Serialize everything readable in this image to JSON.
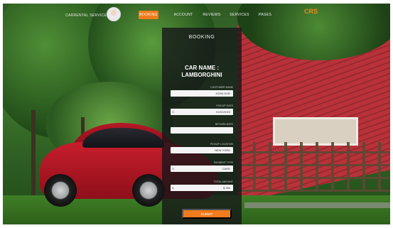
{
  "nav": {
    "brand": "CARRENTAL SERVICE",
    "items": [
      {
        "label": "BOOKING",
        "active": true
      },
      {
        "label": "ACCOUNT",
        "active": false
      },
      {
        "label": "REVIEWS",
        "active": false
      },
      {
        "label": "SERVICES",
        "active": false
      },
      {
        "label": "PAGES",
        "active": false
      }
    ],
    "logo": "CRS"
  },
  "booking": {
    "title": "BOOKING",
    "car_name_line1": "CAR NAME :",
    "car_name_line2": "LAMBORGHINI",
    "fields": [
      {
        "label": "CUSTOMER NAME",
        "value": "JOHN DOE",
        "lead": ""
      },
      {
        "label": "PICKUP DATE",
        "value": "01/01/2023",
        "lead": "O"
      },
      {
        "label": "RETURN DATE",
        "value": "",
        "lead": ""
      },
      {
        "label": "PICKUP LOCATION",
        "value": "NEW YORK",
        "lead": ""
      },
      {
        "label": "PAYMENT TYPE",
        "value": "CARD",
        "lead": "O"
      },
      {
        "label": "TOTAL AMOUNT",
        "value": "$ 250",
        "lead": "$"
      }
    ],
    "submit_label": "SUBMIT"
  },
  "colors": {
    "accent": "#f07c1e",
    "panel": "#141618",
    "car": "#c81e2c"
  }
}
